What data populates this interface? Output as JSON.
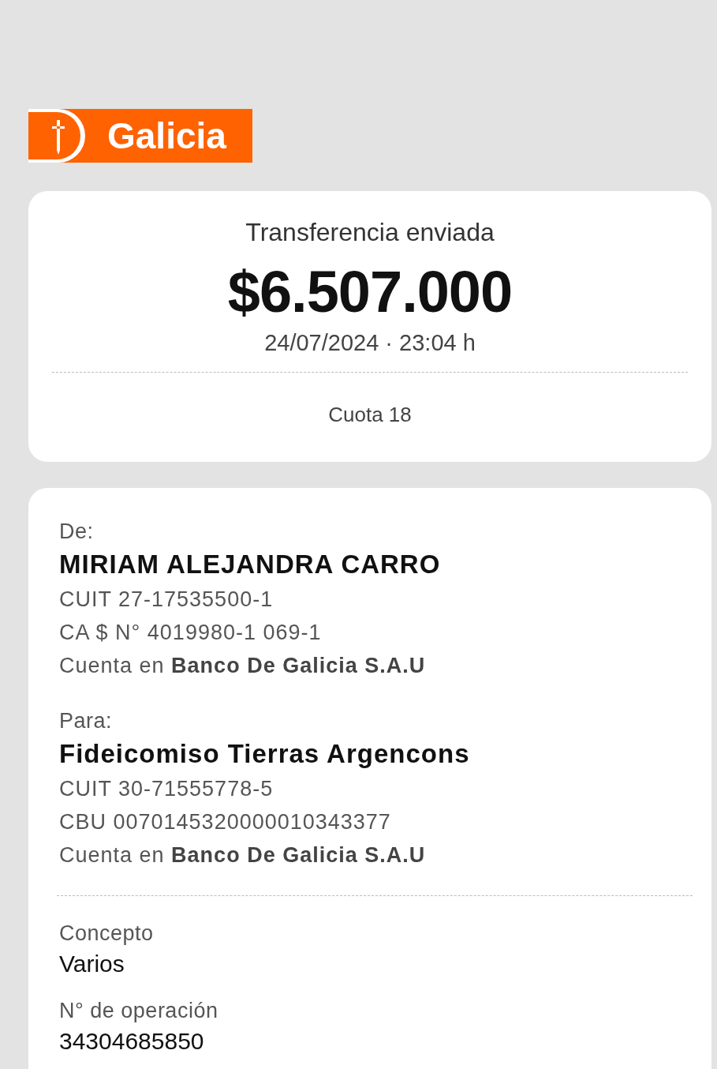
{
  "logo": {
    "text": "Galicia"
  },
  "summary": {
    "title": "Transferencia enviada",
    "amount": "$6.507.000",
    "datetime": "24/07/2024 · 23:04 h",
    "note": "Cuota 18"
  },
  "parties": [
    {
      "label": "De:",
      "name": "MIRIAM ALEJANDRA CARRO",
      "lines": [
        "CUIT 27-17535500-1",
        "CA $ N° 4019980-1 069-1",
        "Cuenta en **Banco De Galicia S.A.U**"
      ]
    },
    {
      "label": "Para:",
      "name": "Fideicomiso Tierras Argencons",
      "lines": [
        "CUIT 30-71555778-5",
        "CBU 0070145320000010343377",
        "Cuenta en **Banco De Galicia S.A.U**"
      ]
    }
  ],
  "fields": [
    {
      "label": "Concepto",
      "value": "Varios"
    },
    {
      "label": "N° de operación",
      "value": "34304685850"
    }
  ]
}
